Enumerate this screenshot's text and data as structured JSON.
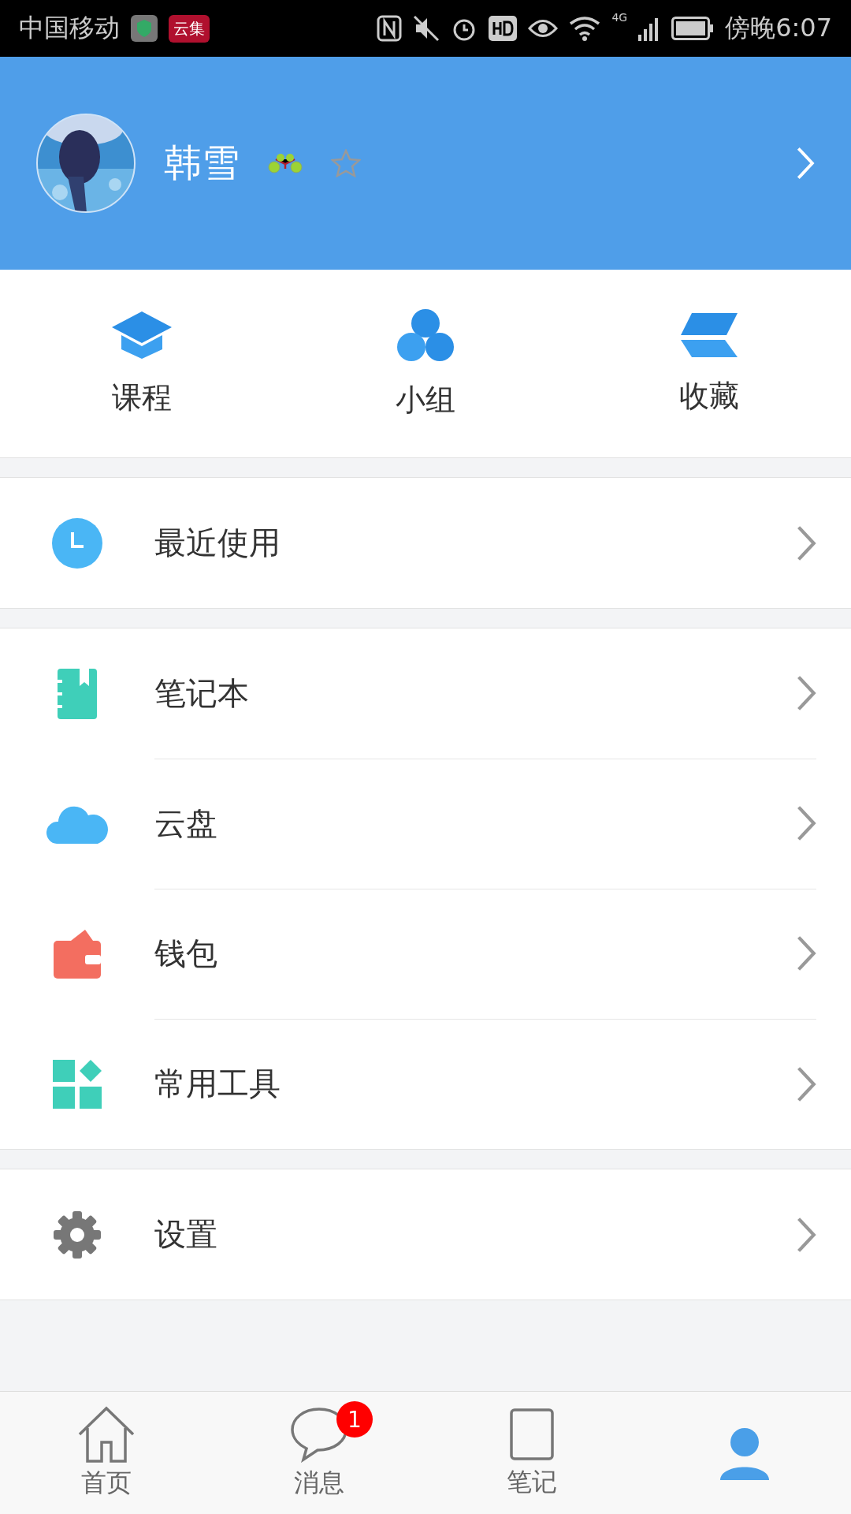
{
  "status_bar": {
    "carrier": "中国移动",
    "app_badge": "云集",
    "network": "4G",
    "time": "傍晚6:07"
  },
  "profile": {
    "name": "韩雪"
  },
  "shortcuts": [
    {
      "label": "课程",
      "kind": "cap"
    },
    {
      "label": "小组",
      "kind": "circles"
    },
    {
      "label": "收藏",
      "kind": "layers"
    }
  ],
  "menu_groups": [
    [
      {
        "label": "最近使用",
        "kind": "clock"
      }
    ],
    [
      {
        "label": "笔记本",
        "kind": "notebook"
      },
      {
        "label": "云盘",
        "kind": "cloud"
      },
      {
        "label": "钱包",
        "kind": "wallet"
      },
      {
        "label": "常用工具",
        "kind": "tools"
      }
    ],
    [
      {
        "label": "设置",
        "kind": "gear"
      }
    ]
  ],
  "tab_bar": [
    {
      "label": "首页",
      "kind": "home",
      "selected": false
    },
    {
      "label": "消息",
      "kind": "chat",
      "selected": false,
      "badge": "1"
    },
    {
      "label": "笔记",
      "kind": "note",
      "selected": false
    },
    {
      "kind": "person",
      "selected": true
    }
  ]
}
